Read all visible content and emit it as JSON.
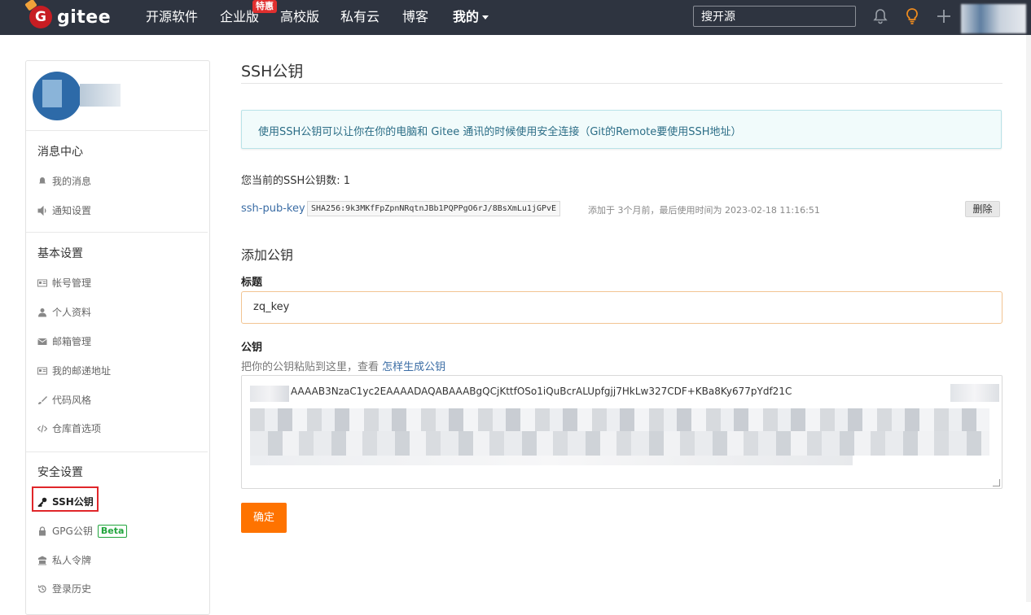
{
  "nav": {
    "logo_text": "gitee",
    "items": [
      "开源软件",
      "企业版",
      "高校版",
      "私有云",
      "博客",
      "我的"
    ],
    "hot_badge": "特惠",
    "search_placeholder": "搜开源"
  },
  "sidebar": {
    "sections": [
      {
        "title": "消息中心",
        "items": [
          "我的消息",
          "通知设置"
        ]
      },
      {
        "title": "基本设置",
        "items": [
          "帐号管理",
          "个人资料",
          "邮箱管理",
          "我的邮递地址",
          "代码风格",
          "仓库首选项"
        ]
      },
      {
        "title": "安全设置",
        "items": [
          "SSH公钥",
          "GPG公钥",
          "私人令牌",
          "登录历史"
        ]
      }
    ],
    "beta_label": "Beta"
  },
  "main": {
    "title": "SSH公钥",
    "info": "使用SSH公钥可以让你在你的电脑和 Gitee 通讯的时候使用安全连接（Git的Remote要使用SSH地址）",
    "count_text": "您当前的SSH公钥数: 1",
    "key": {
      "name": "ssh-pub-key",
      "fingerprint": "SHA256:9k3MKfFpZpnNRqtnJBb1PQPPgO6rJ/8BsXmLu1jGPvE",
      "meta": "添加于 3个月前，最后使用时间为 2023-02-18 11:16:51",
      "delete_label": "删除"
    },
    "add_title": "添加公钥",
    "title_label": "标题",
    "title_value": "zq_key",
    "key_label": "公钥",
    "hint_prefix": "把你的公钥粘贴到这里，查看",
    "hint_link": "怎样生成公钥",
    "key_value_visible": "AAAAB3NzaC1yc2EAAAADAQABAAABgQCjKttfOSo1iQuBcrALUpfgjj7HkLw327CDF+KBa8Ky677pYdf21C",
    "submit_label": "确定"
  },
  "colors": {
    "nav_bg": "#2e3440",
    "accent": "#fe7300",
    "link": "#3b6da5",
    "highlight": "#e0262a",
    "beta": "#21a53d"
  }
}
